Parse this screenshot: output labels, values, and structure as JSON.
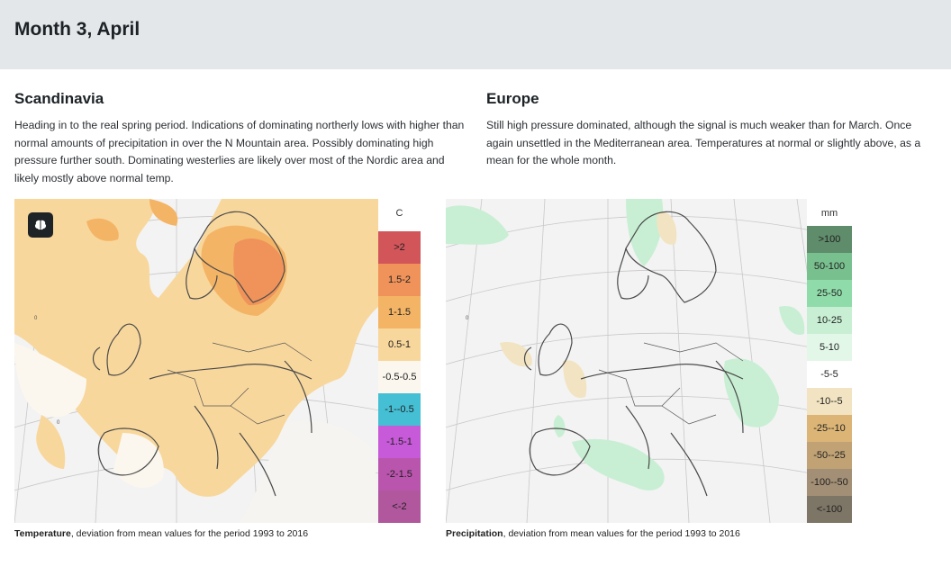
{
  "header": {
    "title": "Month 3, April"
  },
  "sections": [
    {
      "title": "Scandinavia",
      "text": "Heading in to the real spring period. Indications of dominating northerly lows with higher than normal amounts of precipitation in over the N Mountain area. Possibly dominating high pressure further south. Dominating westerlies are likely over most of the Nordic area and likely mostly above normal temp."
    },
    {
      "title": "Europe",
      "text": "Still high pressure dominated, although the signal is much weaker than for March. Once again unsettled in the Mediterranean area. Temperatures at normal or slightly above, as a mean for the whole month."
    }
  ],
  "temperature_map": {
    "icon": "brain-icon",
    "legend_unit": "C",
    "legend": [
      {
        "label": ">2",
        "color": "#d2555a"
      },
      {
        "label": "1.5-2",
        "color": "#ef935a"
      },
      {
        "label": "1-1.5",
        "color": "#f4b466"
      },
      {
        "label": "0.5-1",
        "color": "#f8d79c"
      },
      {
        "label": "-0.5-0.5",
        "color": "#fbf7ee"
      },
      {
        "label": "-1--0.5",
        "color": "#45bfd4"
      },
      {
        "label": "-1.5-1",
        "color": "#c75ad8"
      },
      {
        "label": "-2-1.5",
        "color": "#ba55ad"
      },
      {
        "label": "<-2",
        "color": "#b0579e"
      }
    ],
    "caption_bold": "Temperature",
    "caption_rest": ", deviation from mean values for the period 1993 to 2016"
  },
  "precipitation_map": {
    "legend_unit": "mm",
    "legend": [
      {
        "label": ">100",
        "color": "#5f8c6b"
      },
      {
        "label": "50-100",
        "color": "#79c08f"
      },
      {
        "label": "25-50",
        "color": "#8fdcaa"
      },
      {
        "label": "10-25",
        "color": "#c8efd4"
      },
      {
        "label": "5-10",
        "color": "#e2f7e8"
      },
      {
        "label": "-5-5",
        "color": "#ffffff"
      },
      {
        "label": "-10--5",
        "color": "#f2e4c2"
      },
      {
        "label": "-25--10",
        "color": "#dcb576"
      },
      {
        "label": "-50--25",
        "color": "#c0a274"
      },
      {
        "label": "-100--50",
        "color": "#a38f75"
      },
      {
        "label": "<-100",
        "color": "#7d7565"
      }
    ],
    "caption_bold": "Precipitation",
    "caption_rest": ", deviation from mean values for the period 1993 to 2016"
  }
}
